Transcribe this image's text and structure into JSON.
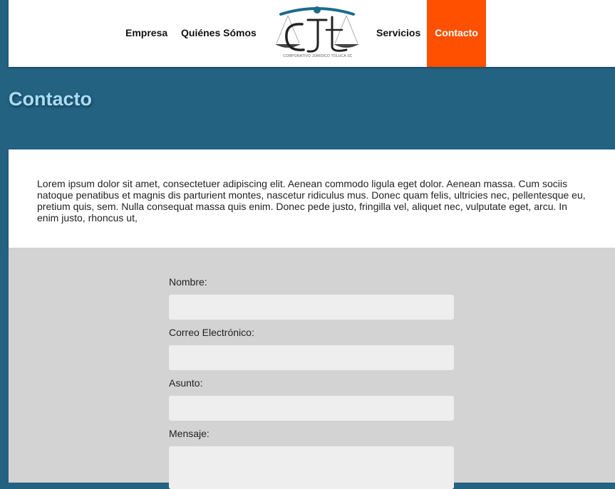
{
  "nav": {
    "empresa": "Empresa",
    "quienes": "Quiénes Sómos",
    "servicios": "Servicios",
    "contacto": "Contacto",
    "active_color": "#ff5000"
  },
  "logo": {
    "monogram": "CJT",
    "tagline": "CORPORATIVO JURÍDICO TOLUCA SC"
  },
  "page": {
    "title": "Contacto",
    "intro": "Lorem ipsum dolor sit amet, consectetuer adipiscing elit. Aenean commodo ligula eget dolor. Aenean massa. Cum sociis natoque penatibus et magnis dis parturient montes, nascetur ridiculus mus. Donec quam felis, ultricies nec, pellentesque eu, pretium quis, sem. Nulla consequat massa quis enim. Donec pede justo, fringilla vel, aliquet nec, vulputate eget, arcu. In enim justo, rhoncus ut,"
  },
  "form": {
    "nombre_label": "Nombre:",
    "correo_label": "Correo Electrónico:",
    "asunto_label": "Asunto:",
    "mensaje_label": "Mensaje:",
    "nombre_value": "",
    "correo_value": "",
    "asunto_value": "",
    "mensaje_value": ""
  },
  "colors": {
    "background": "#246282",
    "title": "#a9ddf6",
    "form_bg": "#d3d3d3"
  }
}
